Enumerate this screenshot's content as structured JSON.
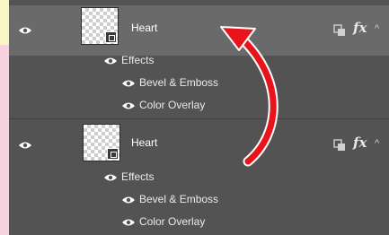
{
  "layers": [
    {
      "name": "Heart",
      "selected": true,
      "effects_label": "Effects",
      "effects": [
        "Bevel & Emboss",
        "Color Overlay"
      ],
      "fx_label": "fx",
      "chevron": "^"
    },
    {
      "name": "Heart",
      "selected": false,
      "effects_label": "Effects",
      "effects": [
        "Bevel & Emboss",
        "Color Overlay"
      ],
      "fx_label": "fx",
      "chevron": "^"
    }
  ],
  "annotation": {
    "icon": "curved-arrow-icon",
    "color": "#e8141c"
  },
  "colors": {
    "panel": "#535353",
    "selected_row": "#6a6a6a",
    "background": "#f9f6c6",
    "left_strip": "#f7d2e0"
  }
}
